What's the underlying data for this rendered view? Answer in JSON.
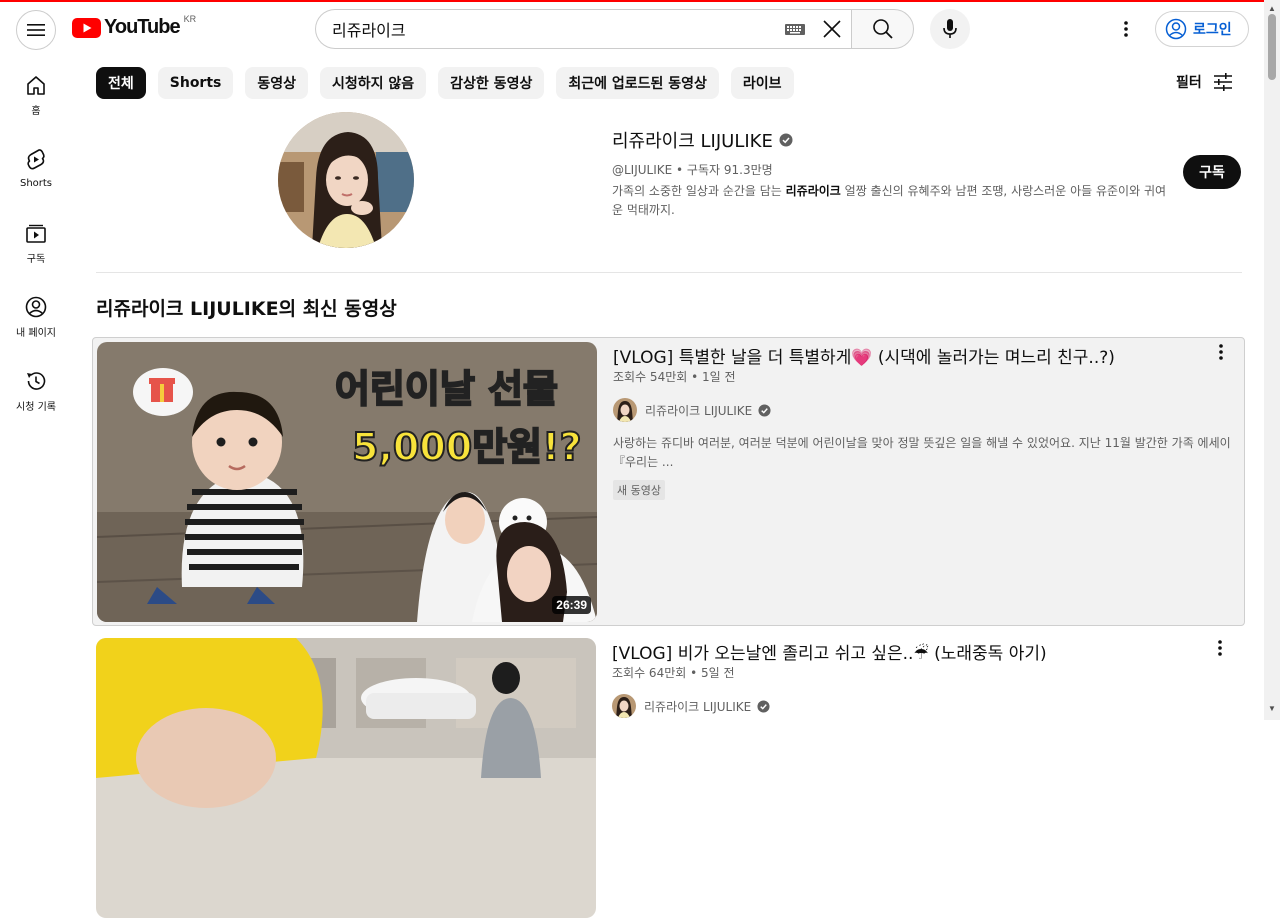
{
  "header": {
    "logo_text": "YouTube",
    "logo_region": "KR",
    "search_value": "리쥬라이크",
    "signin_label": "로그인"
  },
  "guide": [
    {
      "label": "홈",
      "icon": "home-icon"
    },
    {
      "label": "Shorts",
      "icon": "shorts-icon"
    },
    {
      "label": "구독",
      "icon": "subscriptions-icon"
    },
    {
      "label": "내 페이지",
      "icon": "you-icon"
    },
    {
      "label": "시청 기록",
      "icon": "history-icon"
    }
  ],
  "chips": [
    "전체",
    "Shorts",
    "동영상",
    "시청하지 않음",
    "감상한 동영상",
    "최근에 업로드된 동영상",
    "라이브"
  ],
  "filter_label": "필터",
  "channel": {
    "name": "리쥬라이크 LIJULIKE",
    "handle_subs": "@LIJULIKE • 구독자 91.3만명",
    "desc_pre": "가족의 소중한 일상과 순간을 담는 ",
    "desc_bold": "리쥬라이크",
    "desc_post": " 얼짱 출신의 유혜주와 남편 조땡, 사랑스러운 아들 유준이와 귀여운 먹태까지.",
    "subscribe_label": "구독"
  },
  "shelf_title": "리쥬라이크 LIJULIKE의 최신 동영상",
  "videos": [
    {
      "title": "[VLOG] 특별한 날을 더 특별하게💗 (시댁에 놀러가는 며느리 친구..?)",
      "meta": "조회수 54만회 • 1일 전",
      "channel": "리쥬라이크 LIJULIKE",
      "desc": "사랑하는 쥬디바 여러분, 여러분 덕분에 어린이날을 맞아 정말 뜻깊은 일을 해낼 수 있었어요. 지난 11월 발간한 가족 에세이 『우리는 ...",
      "badge": "새 동영상",
      "duration": "26:39",
      "thumb_text1": "어린이날 선물",
      "thumb_text2": "5,000만원!?"
    },
    {
      "title": "[VLOG] 비가 오는날엔 졸리고 쉬고 싶은..☔ (노래중독 아기)",
      "meta": "조회수 64만회 • 5일 전",
      "channel": "리쥬라이크 LIJULIKE"
    }
  ]
}
